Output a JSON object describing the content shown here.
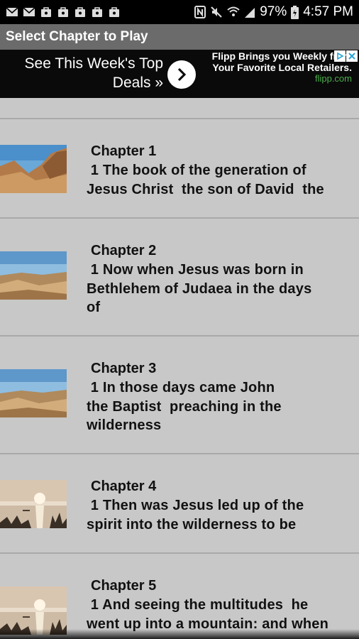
{
  "status_bar": {
    "battery_percent": "97%",
    "time": "4:57 PM",
    "notification_icons": [
      "mail-icon",
      "mail-icon",
      "bag-icon",
      "bag-icon",
      "bag-icon",
      "bag-icon",
      "bag-icon"
    ]
  },
  "app_bar": {
    "title": "Select Chapter to Play"
  },
  "ad": {
    "headline": "See This Week's Top Deals »",
    "right_text": "Flipp Brings you Weekly from Your Favorite Local Retailers.",
    "domain": "flipp.com"
  },
  "chapters": [
    {
      "title": "Chapter 1",
      "text": " 1 The book of the generation of\nJesus Christ  the son of David  the",
      "thumb": "desert-canyon"
    },
    {
      "title": "Chapter 2",
      "text": " 1 Now when Jesus was born in\nBethlehem of Judaea in the days\nof",
      "thumb": "desert-plain"
    },
    {
      "title": "Chapter 3",
      "text": " 1 In those days came John\nthe Baptist  preaching in the\nwilderness",
      "thumb": "desert-plain"
    },
    {
      "title": "Chapter 4",
      "text": " 1 Then was Jesus led up of the\nspirit into the wilderness to be",
      "thumb": "lake-sunset"
    },
    {
      "title": "Chapter 5",
      "text": " 1 And seeing the multitudes  he\nwent up into a mountain: and when",
      "thumb": "lake-sunset"
    }
  ]
}
